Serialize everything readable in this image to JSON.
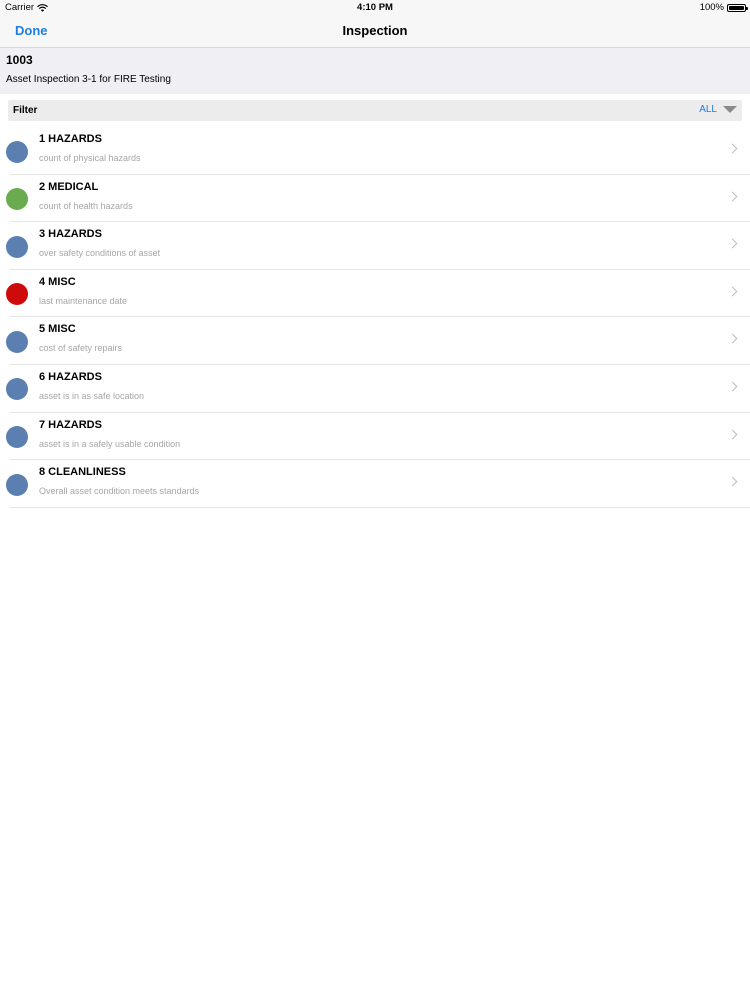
{
  "status": {
    "carrier": "Carrier",
    "time": "4:10 PM",
    "battery": "100%"
  },
  "nav": {
    "done_label": "Done",
    "title": "Inspection"
  },
  "asset": {
    "id": "1003",
    "description": "Asset Inspection 3-1 for FIRE Testing"
  },
  "filter": {
    "label": "Filter",
    "value": "ALL"
  },
  "colors": {
    "accent": "#1f7fe0",
    "blue": "#5b7fb0",
    "green": "#6aab4f",
    "red": "#cf0a0a"
  },
  "items": [
    {
      "title": "1 HAZARDS",
      "subtitle": "count of physical hazards",
      "color": "#5b7fb0"
    },
    {
      "title": "2 MEDICAL",
      "subtitle": "count of health hazards",
      "color": "#6aab4f"
    },
    {
      "title": "3 HAZARDS",
      "subtitle": "over safety conditions of asset",
      "color": "#5b7fb0"
    },
    {
      "title": "4 MISC",
      "subtitle": "last maintenance date",
      "color": "#cf0a0a"
    },
    {
      "title": "5 MISC",
      "subtitle": "cost of safety repairs",
      "color": "#5b7fb0"
    },
    {
      "title": "6 HAZARDS",
      "subtitle": "asset is in as safe location",
      "color": "#5b7fb0"
    },
    {
      "title": "7 HAZARDS",
      "subtitle": "asset is in a safely usable condition",
      "color": "#5b7fb0"
    },
    {
      "title": "8 CLEANLINESS",
      "subtitle": "Overall asset condition meets standards",
      "color": "#5b7fb0"
    }
  ]
}
